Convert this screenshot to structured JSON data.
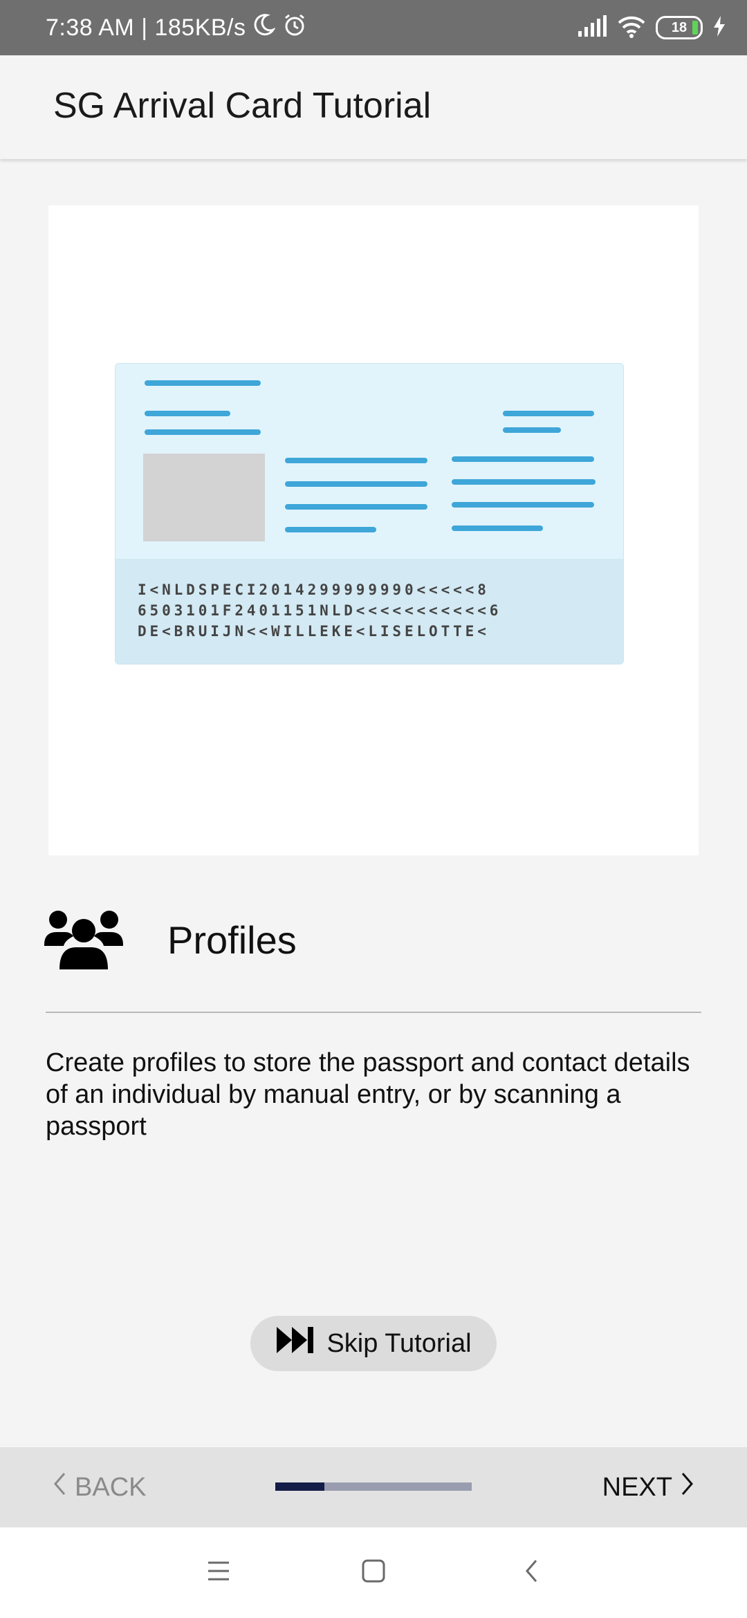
{
  "status_bar": {
    "time": "7:38 AM | 185KB/s",
    "battery": "18",
    "icons": [
      "moon-icon",
      "alarm-icon",
      "signal-icon",
      "wifi-icon",
      "battery-icon",
      "charging-icon"
    ]
  },
  "app_bar": {
    "title": "SG Arrival Card Tutorial"
  },
  "illustration": {
    "mrz_lines": [
      "I<NLDSPECI2014299999990<<<<<8",
      "6503101F2401151NLD<<<<<<<<<<<6",
      "DE<BRUIJN<<WILLEKE<LISELOTTE<"
    ]
  },
  "feature": {
    "icon": "people-group-icon",
    "title": "Profiles",
    "description": "Create profiles to store the passport and contact details of an individual by manual entry, or by scanning a passport"
  },
  "skip": {
    "label": "Skip Tutorial",
    "icon": "fast-forward-icon"
  },
  "nav": {
    "back_label": "BACK",
    "next_label": "NEXT",
    "progress": 0.25
  },
  "colors": {
    "status_bar": "#6f6f6f",
    "card_lines": "#3ea6d8",
    "card_bg": "#e1f4fc",
    "progress_fill": "#141c48",
    "progress_track": "#9a9db0"
  }
}
